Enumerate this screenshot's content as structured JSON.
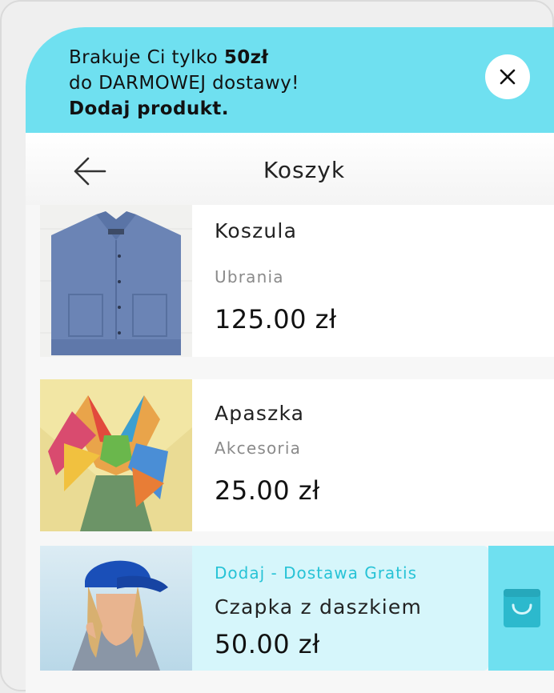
{
  "banner": {
    "line1_prefix": "Brakuje Ci tylko ",
    "line1_amount": "50zł",
    "line2": "do DARMOWEJ dostawy!",
    "line3": "Dodaj produkt."
  },
  "header": {
    "title": "Koszyk"
  },
  "cart": {
    "items": [
      {
        "name": "Koszula",
        "category": "Ubrania",
        "price": "125.00 zł"
      },
      {
        "name": "Apaszka",
        "category": "Akcesoria",
        "price": "25.00 zł"
      }
    ],
    "suggestion": {
      "promo": "Dodaj - Dostawa Gratis",
      "name": "Czapka z daszkiem",
      "price": "50.00 zł"
    }
  },
  "icons": {
    "close": "close-icon",
    "back": "arrow-left-icon",
    "cart": "shopping-bag-icon"
  },
  "colors": {
    "accent": "#6fe0f0",
    "suggestion_bg": "#d6f6fb",
    "promo_text": "#27c3d6"
  }
}
